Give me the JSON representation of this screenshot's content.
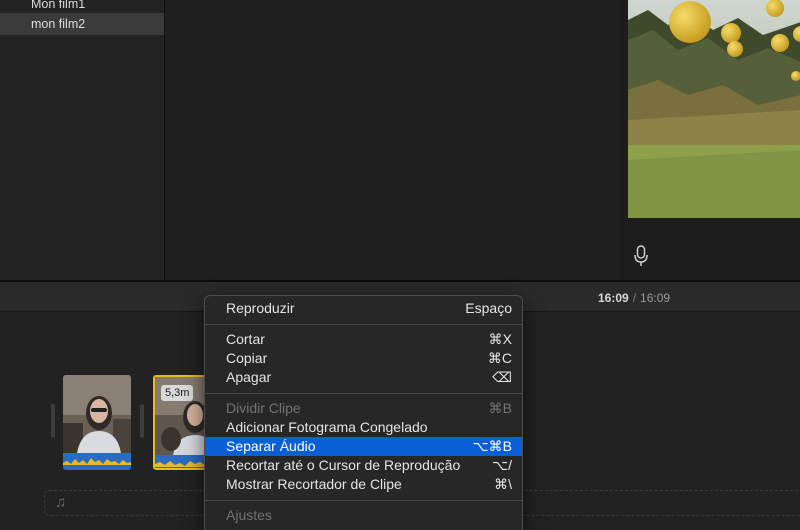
{
  "library": {
    "items": [
      {
        "label": "Mon film1"
      },
      {
        "label": "mon film2",
        "selected": true
      }
    ]
  },
  "viewer": {
    "icons": {
      "record_voiceover": "microphone-icon"
    }
  },
  "timeline": {
    "timecode": {
      "current": "16:09",
      "separator": "/",
      "total": "16:09"
    },
    "clips": [
      {
        "name": "clip-1",
        "selected": false
      },
      {
        "name": "clip-2",
        "selected": true,
        "duration_label": "5,3m"
      }
    ],
    "music_track_icon": "music-note-icon"
  },
  "context_menu": {
    "items": [
      {
        "label": "Reproduzir",
        "shortcut": "Espaço",
        "enabled": true
      },
      {
        "label": "Cortar",
        "shortcut": "⌘X",
        "enabled": true
      },
      {
        "label": "Copiar",
        "shortcut": "⌘C",
        "enabled": true
      },
      {
        "label": "Apagar",
        "shortcut": "⌫",
        "enabled": true
      },
      {
        "label": "Dividir Clipe",
        "shortcut": "⌘B",
        "enabled": false
      },
      {
        "label": "Adicionar Fotograma Congelado",
        "shortcut": "",
        "enabled": true
      },
      {
        "label": "Separar Áudio",
        "shortcut": "⌥⌘B",
        "enabled": true,
        "highlighted": true
      },
      {
        "label": "Recortar até o Cursor de Reprodução",
        "shortcut": "⌥/",
        "enabled": true
      },
      {
        "label": "Mostrar Recortador de Clipe",
        "shortcut": "⌘\\",
        "enabled": true
      },
      {
        "label": "Ajustes",
        "shortcut": "",
        "enabled": false
      }
    ]
  },
  "colors": {
    "selection_highlight": "#0a5fd6",
    "selected_clip_border": "#e8b923",
    "audio_track": "#2a6cc2",
    "waveform": "#e8b923"
  }
}
